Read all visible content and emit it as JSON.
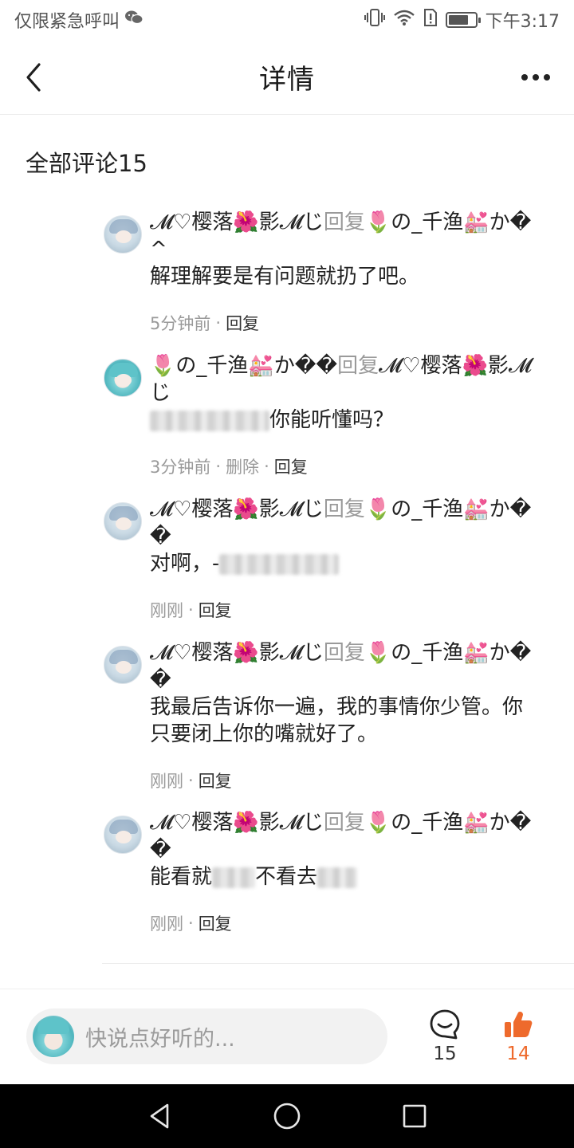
{
  "status_bar": {
    "carrier": "仅限紧急呼叫",
    "time": "下午3:17",
    "battery_level": 0.75,
    "icons": [
      "wechat-icon",
      "vibrate-icon",
      "wifi-icon",
      "sim-alert-icon",
      "battery-icon"
    ]
  },
  "header": {
    "title": "详情",
    "back_icon": "chevron-left-icon",
    "more_icon": "more-dots-icon"
  },
  "section": {
    "title": "全部评论15"
  },
  "comments": [
    {
      "author": "𝓜♡樱落🌺影𝓜じ",
      "reply_word": "回复",
      "target": "🌷の_千渔💒か�^",
      "text": "解理解要是有问题就扔了吧。",
      "time": "5分钟前",
      "actions": [
        "回复"
      ]
    },
    {
      "author": "🌷の_千渔💒か��",
      "reply_word": "回复",
      "target": "𝓜♡樱落🌺影𝓜じ",
      "text": "你能听懂吗？",
      "time": "3分钟前",
      "actions": [
        "删除",
        "回复"
      ]
    },
    {
      "author": "𝓜♡樱落🌺影𝓜じ",
      "reply_word": "回复",
      "target": "🌷の_千渔💒か��",
      "text": "对啊，-",
      "time": "刚刚",
      "actions": [
        "回复"
      ]
    },
    {
      "author": "𝓜♡樱落🌺影𝓜じ",
      "reply_word": "回复",
      "target": "🌷の_千渔💒か��",
      "text": "我最后告诉你一遍，我的事情你少管。你只要闭上你的嘴就好了。",
      "time": "刚刚",
      "actions": [
        "回复"
      ]
    },
    {
      "author": "𝓜♡樱落🌺影𝓜じ",
      "reply_word": "回复",
      "target": "🌷の_千渔💒か��",
      "text": "能看就",
      "text_after": "不看去",
      "time": "刚刚",
      "actions": [
        "回复"
      ]
    }
  ],
  "bottom_bar": {
    "input_placeholder": "快说点好听的...",
    "comment_count": "15",
    "like_count": "14",
    "like_color": "#ee6a2c"
  },
  "nav_bar": {
    "icons": [
      "back-triangle-icon",
      "home-circle-icon",
      "recents-square-icon"
    ]
  }
}
